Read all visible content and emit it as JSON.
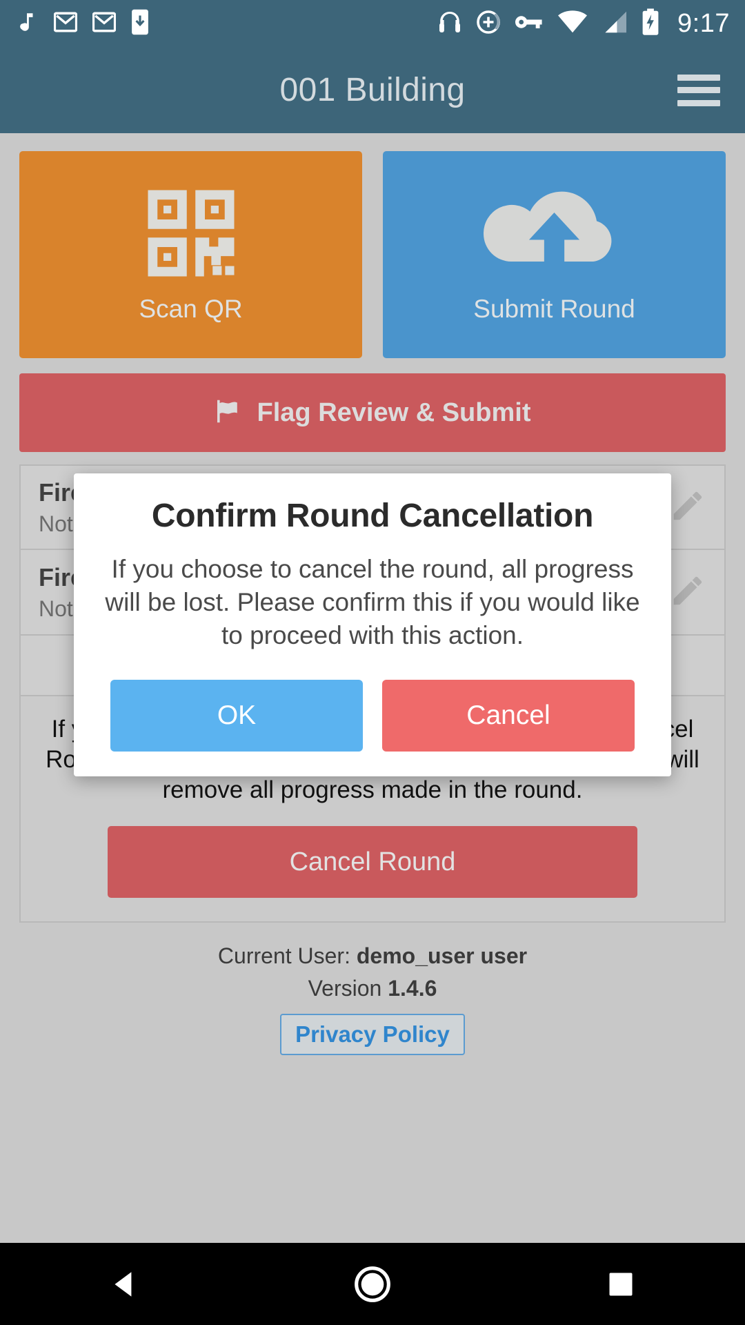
{
  "status_bar": {
    "time": "9:17",
    "left_icons": [
      {
        "name": "music-note-icon"
      },
      {
        "name": "gmail-icon"
      },
      {
        "name": "gmail-icon"
      },
      {
        "name": "phone-download-icon"
      }
    ],
    "right_icons": [
      {
        "name": "headphones-icon"
      },
      {
        "name": "do-not-disturb-add-icon"
      },
      {
        "name": "vpn-key-icon"
      },
      {
        "name": "wifi-icon"
      },
      {
        "name": "cell-signal-icon"
      },
      {
        "name": "battery-charging-icon"
      }
    ],
    "background": "#3d6579"
  },
  "app_bar": {
    "title": "001 Building",
    "menu_icon": "hamburger-menu-icon",
    "background": "#3d6579",
    "title_color": "#d3dade"
  },
  "tiles": [
    {
      "label": "Scan QR",
      "icon": "qr-code-icon",
      "color": "#d9832c"
    },
    {
      "label": "Submit Round",
      "icon": "cloud-upload-icon",
      "color": "#4a94cc"
    }
  ],
  "flag_button": {
    "label": "Flag Review & Submit",
    "icon": "flag-icon",
    "color": "#c9595c"
  },
  "item_list": [
    {
      "title": "Fire Extinguisher",
      "subtitle": "Not Inspected",
      "edit_icon": "pencil-icon"
    },
    {
      "title": "Fire Extinguisher",
      "subtitle": "Not Inspected",
      "edit_icon": "pencil-icon"
    }
  ],
  "cancel_section": {
    "description": "If you would like to exit the round you may press the 'Cancel Round' button below. This is an irreversible operation that will remove all progress made in the round.",
    "button_label": "Cancel Round",
    "button_color": "#c9595c"
  },
  "footer": {
    "current_user_label": "Current User: ",
    "current_user_value": "demo_user user",
    "version_label": "Version ",
    "version_value": "1.4.6",
    "privacy_policy_label": "Privacy Policy",
    "link_color": "#2f85cc"
  },
  "dialog": {
    "title": "Confirm Round Cancellation",
    "message": "If you choose to cancel the round, all progress will be lost. Please confirm this if you would like to proceed with this action.",
    "ok_label": "OK",
    "cancel_label": "Cancel",
    "ok_color": "#5bb3f0",
    "cancel_color": "#ef6a6a"
  },
  "nav_bar": {
    "back_icon": "triangle-back-icon",
    "home_icon": "circle-home-icon",
    "recents_icon": "square-recents-icon",
    "background": "#000000"
  }
}
